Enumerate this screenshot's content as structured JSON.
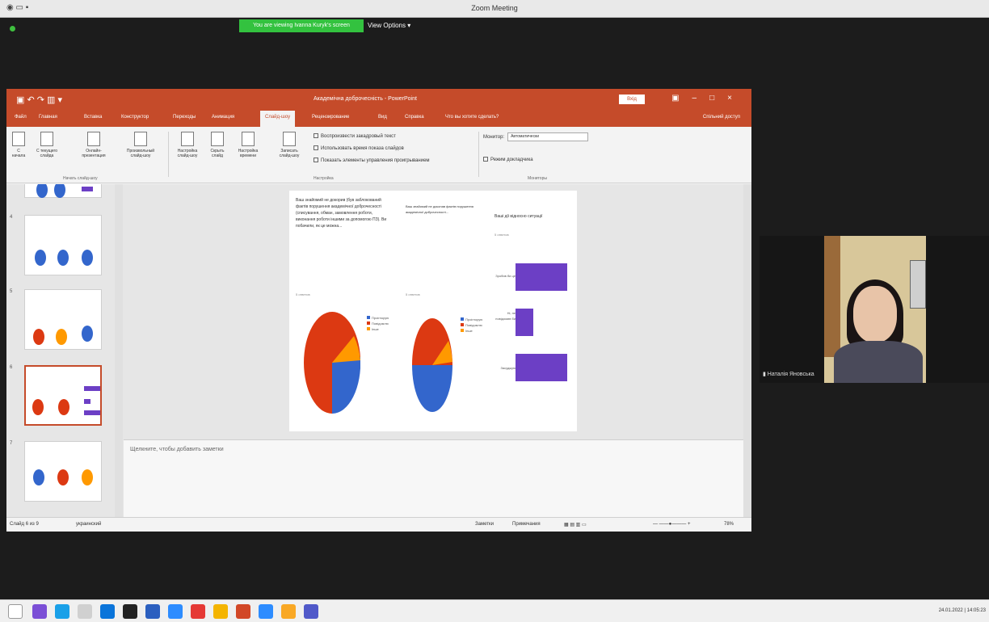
{
  "zoom": {
    "window_title": "Zoom Meeting",
    "share_banner": "You are viewing Ivanna Kuryk's screen",
    "view_options": "View Options ▾"
  },
  "ppt": {
    "doc_title": "Академічна доброчесність - PowerPoint",
    "sign_in": "Вхід",
    "share_access": "Спільний доступ",
    "tabs": [
      "Файл",
      "Главная",
      "Вставка",
      "Конструктор",
      "Переходы",
      "Анимация",
      "Слайд-шоу",
      "Рецензирование",
      "Вид",
      "Справка",
      "Что вы хотите сделать?"
    ],
    "active_tab": "Слайд-шоу",
    "ribbon": {
      "buttons": [
        "С\nначала",
        "С текущего\nслайда",
        "Онлайн-\nпрезентация",
        "Произвольный\nслайд-шоу",
        "Настройка\nслайд-шоу",
        "Скрыть\nслайд",
        "Настройка\nвремени",
        "Записать\nслайд-шоу"
      ],
      "group1": "Начать слайд-шоу",
      "group2": "Настройка",
      "group3": "Мониторы",
      "checks": [
        "Воспроизвести закадровый текст",
        "Использовать время показа слайдов",
        "Показать элементы управления проигрыванием"
      ],
      "monitor_label": "Монитор:",
      "monitor_value": "Автоматически",
      "speaker_view": "Режим докладчика"
    },
    "thumb_numbers": [
      "4",
      "5",
      "6",
      "7"
    ],
    "notes_placeholder": "Щелкните, чтобы добавить заметки",
    "status": {
      "slide": "Слайд 6 из 9",
      "lang": "украинский",
      "notes": "Заметки",
      "comments": "Примечания",
      "zoom": "78%"
    }
  },
  "slide": {
    "q1": "Ваш знайомий не докорив (був заблокований фактів порушення академічної доброчесності (списування, обман, замовлення роботи, виконання роботи іншими за допомогою ПЗ). Ви побачили, як це можна...",
    "q1_answers": "5 ответов",
    "q2": "Ваш знайомий не доконав фактів порушення академічної доброчесності...",
    "q2_answers": "5 ответов",
    "q3": "Ваші дії відносно ситуації",
    "q3_answers": "5 ответов",
    "legend1": [
      "Проігнорую",
      "Повідомлю",
      "Інше"
    ],
    "legend2": [
      "Проігнорую",
      "Повідомлю",
      "Інше"
    ],
    "bar_labels": [
      "Зробив би це",
      "Ні, не повідомив би",
      "Засуджую"
    ],
    "colors": {
      "red": "#dc3912",
      "blue": "#3366cc",
      "orange": "#ff9900",
      "purple": "#6c3fc5"
    }
  },
  "video": {
    "participant": "Наталія Яновська"
  },
  "taskbar": {
    "clock": "24.01.2022 | 14:05:23"
  }
}
